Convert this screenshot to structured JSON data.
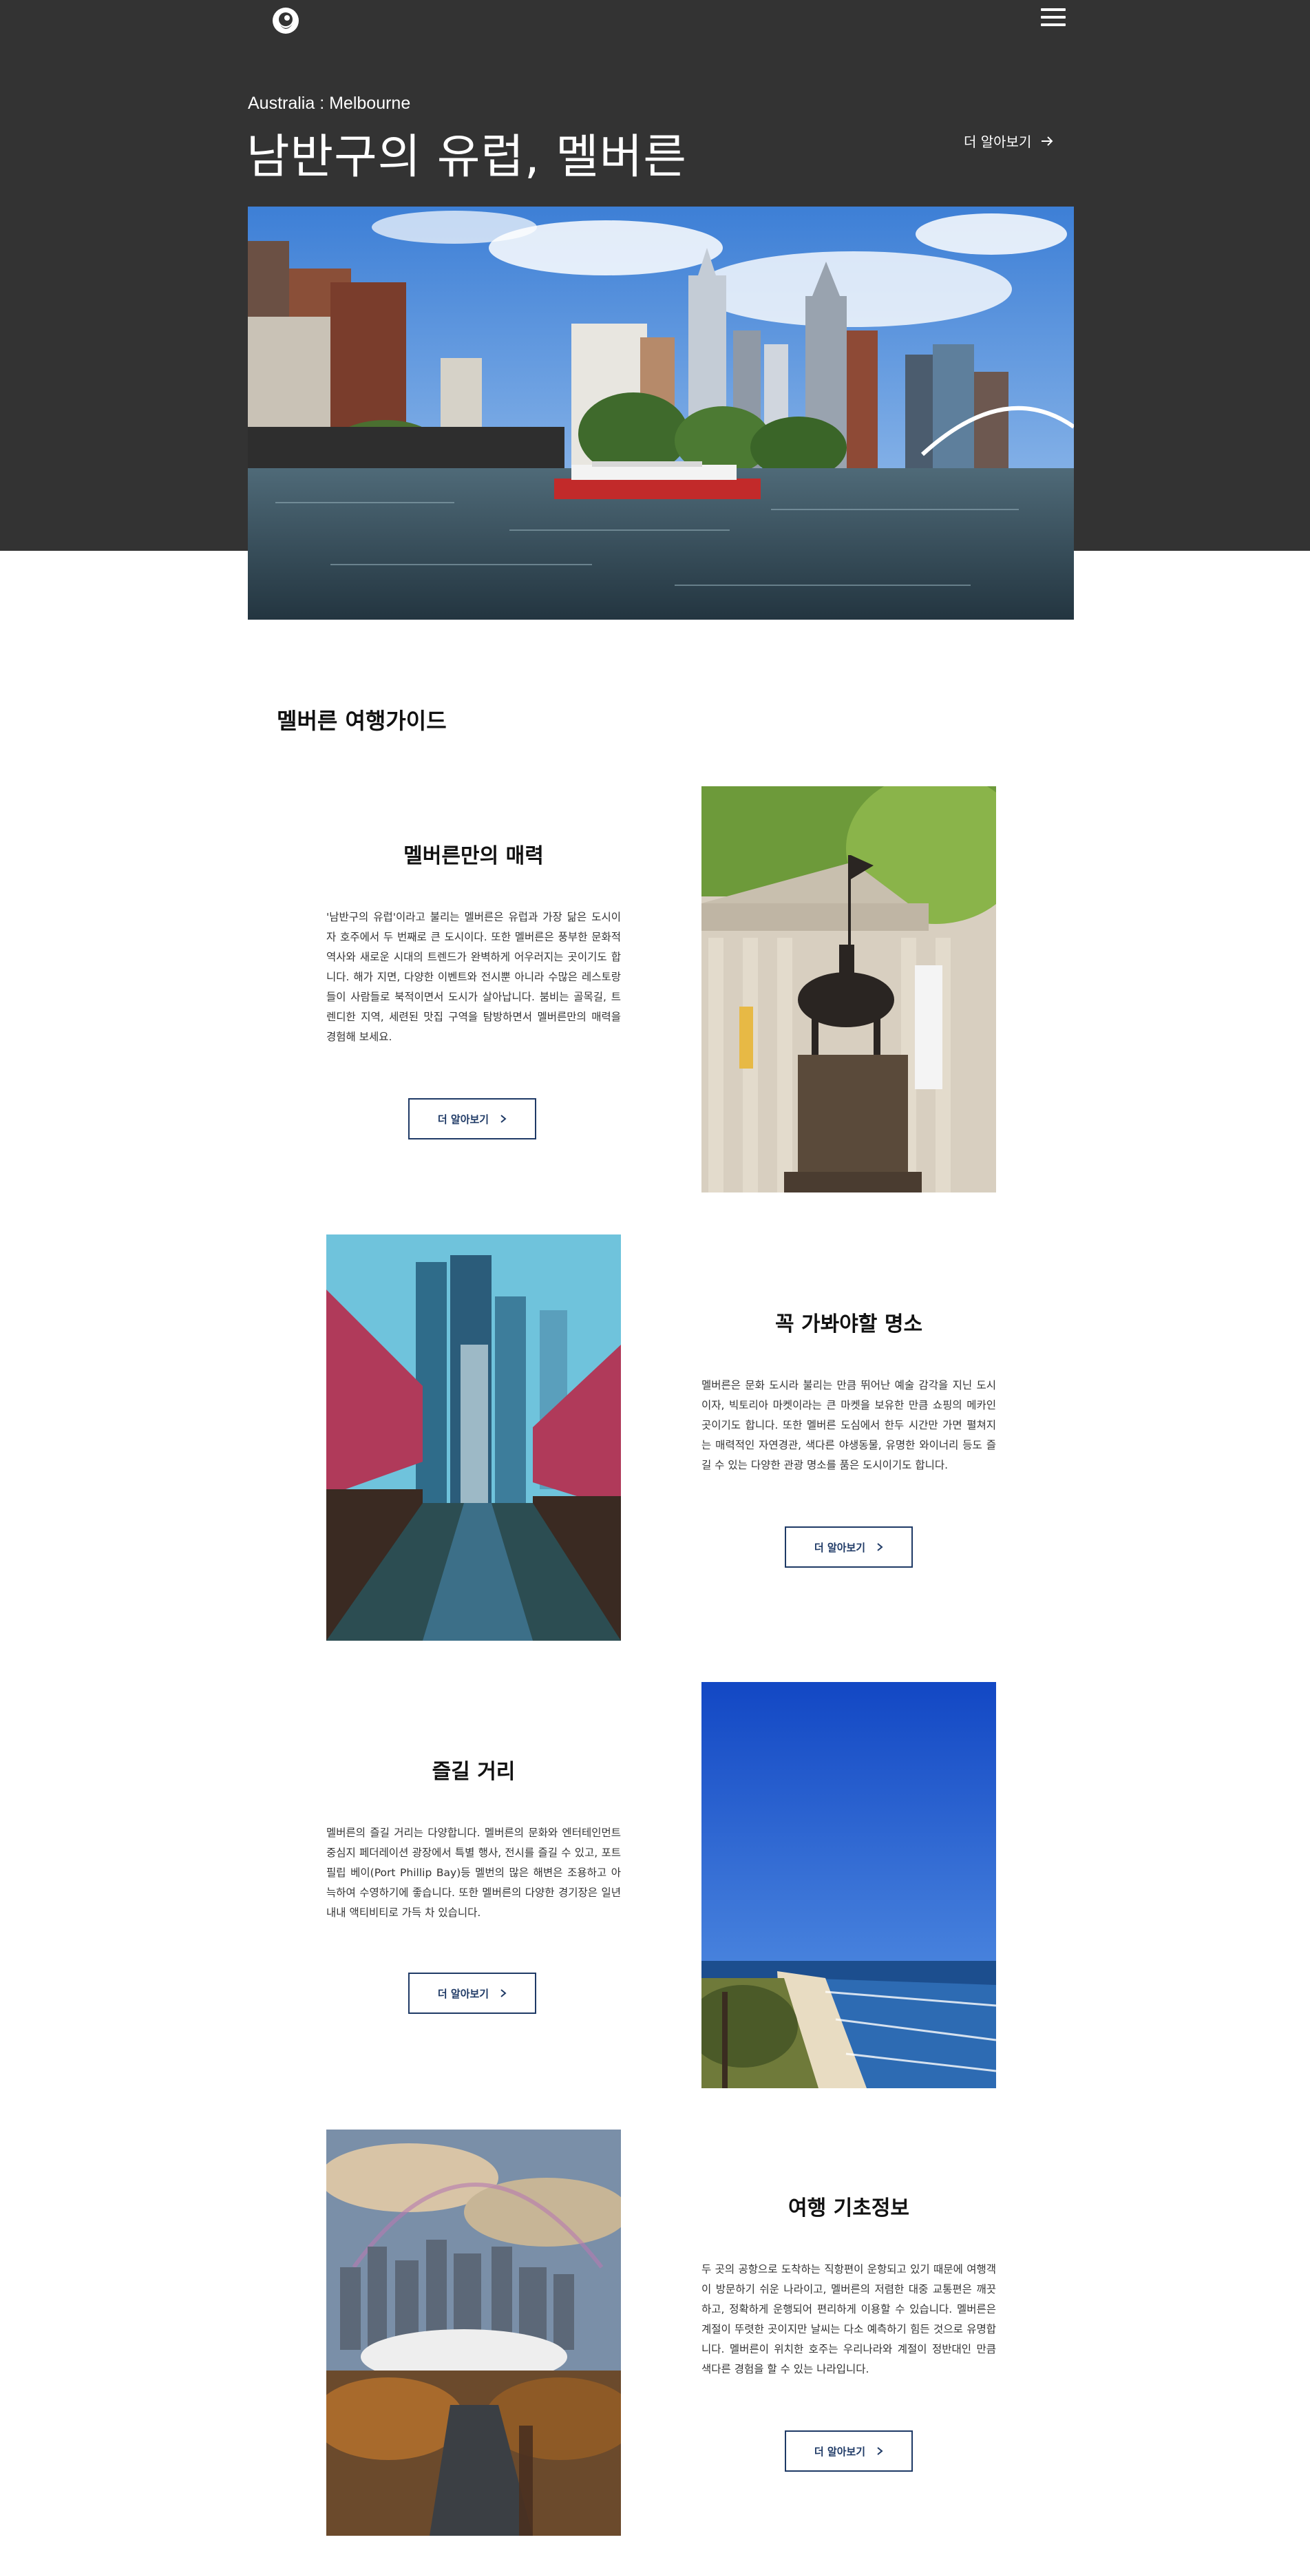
{
  "header": {
    "breadcrumb": "Australia : Melbourne",
    "title": "남반구의 유럽, 멜버른",
    "more_label": "더 알아보기",
    "more_icon": "arrow-right-icon"
  },
  "guide": {
    "title": "멜버른 여행가이드",
    "sections": [
      {
        "title": "멜버른만의 매력",
        "description": "'남반구의 유럽'이라고 불리는 멜버른은 유럽과 가장 닮은 도시이자 호주에서 두 번째로 큰 도시이다. 또한 멜버른은 풍부한 문화적 역사와 새로운 시대의 트렌드가 완벽하게 어우러지는 곳이기도 합니다. 해가 지면, 다양한 이벤트와 전시뿐 아니라 수많은 레스토랑들이 사람들로 북적이면서 도시가 살아납니다. 붐비는 골목길, 트렌디한 지역, 세련된 맛집 구역을 탐방하면서 멜버른만의 매력을 경험해 보세요.",
        "button": "더 알아보기"
      },
      {
        "title": "꼭 가봐야할 명소",
        "description": "멜버른은 문화 도시라 불리는 만큼 뛰어난 예술 감각을 지닌 도시이자, 빅토리아 마켓이라는 큰 마켓을 보유한 만큼 쇼핑의 메카인 곳이기도 합니다. 또한 멜버른 도심에서 한두 시간만 가면 펼쳐지는 매력적인 자연경관, 색다른 야생동물, 유명한 와이너리 등도 즐길 수 있는 다양한 관광 명소를 품은 도시이기도 합니다.",
        "button": "더 알아보기"
      },
      {
        "title": "즐길 거리",
        "description": "멜버른의 즐길 거리는 다양합니다. 멜버른의 문화와 엔터테인먼트 중심지 페더레이션 광장에서 특별 행사, 전시를 즐길 수 있고, 포트 필립 베이(Port Phillip Bay)등 멜번의 많은 해변은 조용하고 아늑하여 수영하기에 좋습니다. 또한 멜버른의 다양한 경기장은 일년 내내 액티비티로 가득 차 있습니다.",
        "button": "더 알아보기"
      },
      {
        "title": "여행 기초정보",
        "description": "두 곳의 공항으로 도착하는 직항편이 운항되고 있기 때문에 여행객이 방문하기 쉬운 나라이고, 멜버른의 저렴한 대중 교통편은 깨끗하고, 정확하게 운행되어 편리하게 이용할 수 있습니다. 멜버른은 계절이 뚜렷한 곳이지만 날씨는 다소 예측하기 힘든 것으로 유명합니다. 멜버른이 위치한 호주는 우리나라와 계절이 정반대인 만큼 색다른 경험을 할 수 있는 나라입니다.",
        "button": "더 알아보기"
      }
    ]
  },
  "icons": {
    "logo": "logo-icon",
    "menu": "hamburger-menu-icon",
    "button_arrow": "chevron-right-icon"
  },
  "colors": {
    "hero_bg": "#333333",
    "button_border": "#1f3a66",
    "text": "#111111"
  }
}
